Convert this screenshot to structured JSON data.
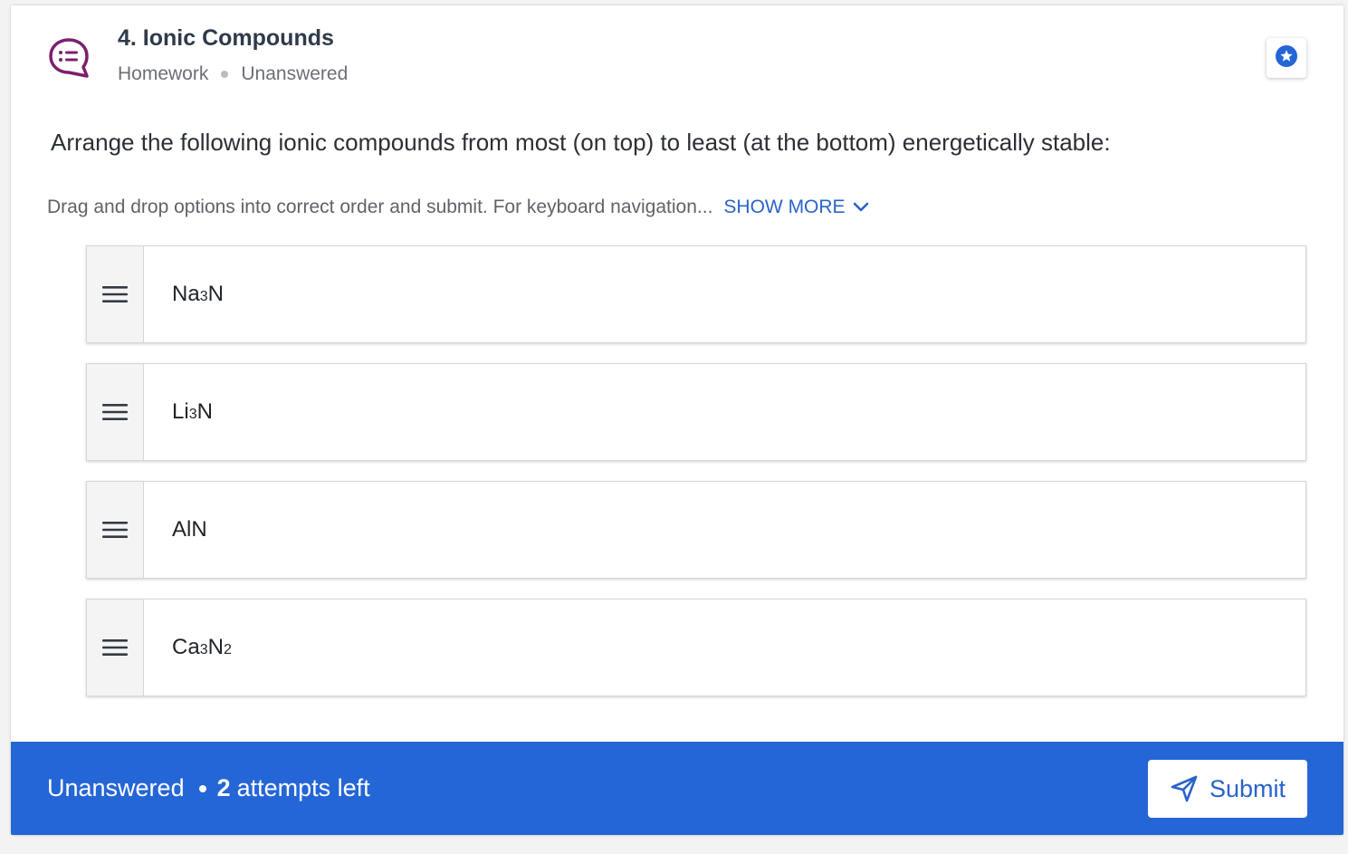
{
  "header": {
    "title": "4. Ionic Compounds",
    "type": "Homework",
    "status": "Unanswered"
  },
  "question": {
    "text": "Arrange the following ionic compounds from most (on top) to least (at the bottom) energetically stable:",
    "instructions": "Drag and drop options into correct order and submit. For keyboard navigation...",
    "show_more_label": "SHOW MORE"
  },
  "options": [
    {
      "base": "Na",
      "sub1": "3",
      "mid": "N",
      "sub2": ""
    },
    {
      "base": "Li",
      "sub1": "3",
      "mid": "N",
      "sub2": ""
    },
    {
      "base": "AlN",
      "sub1": "",
      "mid": "",
      "sub2": ""
    },
    {
      "base": "Ca",
      "sub1": "3",
      "mid": "N",
      "sub2": "2"
    }
  ],
  "footer": {
    "status": "Unanswered",
    "attempts_count": "2",
    "attempts_label": "attempts left",
    "submit_label": "Submit"
  },
  "colors": {
    "accent_blue": "#2466d6",
    "icon_purple": "#7b1f6e",
    "link_blue": "#2a63c9"
  },
  "icons": {
    "question_type": "chat-list-icon",
    "bookmark": "star-badge-icon",
    "drag_handle": "drag-handle-icon",
    "expand": "chevron-down-icon",
    "submit": "paper-plane-icon"
  }
}
